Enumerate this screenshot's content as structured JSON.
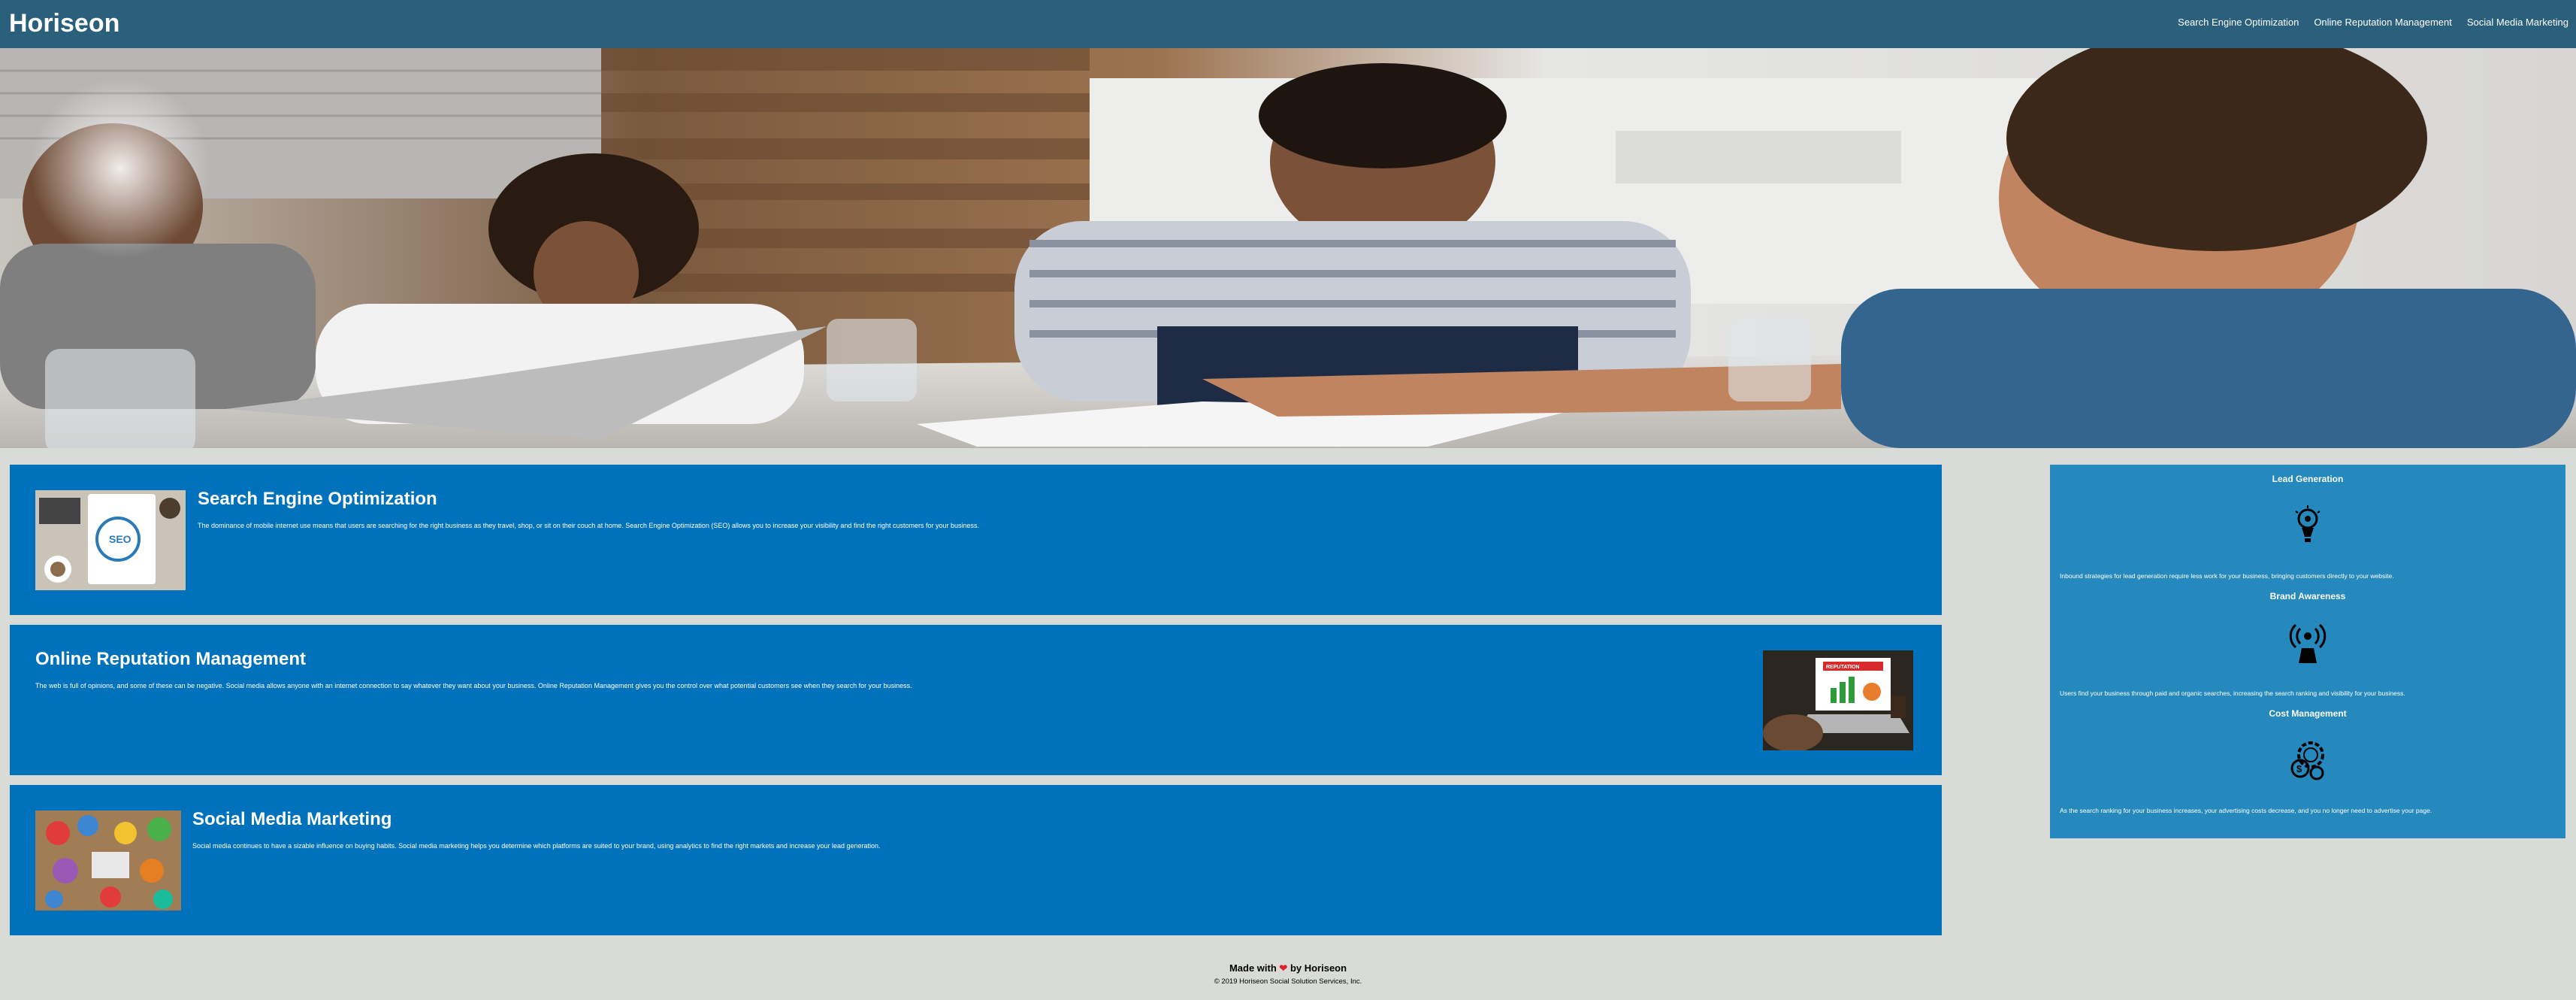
{
  "header": {
    "logo": "Horiseon",
    "nav": [
      "Search Engine Optimization",
      "Online Reputation Management",
      "Social Media Marketing"
    ]
  },
  "cards": [
    {
      "title": "Search Engine Optimization",
      "text": "The dominance of mobile internet use means that users are searching for the right business as they travel, shop, or sit on their couch at home. Search Engine Optimization (SEO) allows you to increase your visibility and find the right customers for your business."
    },
    {
      "title": "Online Reputation Management",
      "text": "The web is full of opinions, and some of these can be negative. Social media allows anyone with an internet connection to say whatever they want about your business. Online Reputation Management gives you the control over what potential customers see when they search for your business."
    },
    {
      "title": "Social Media Marketing",
      "text": "Social media continues to have a sizable influence on buying habits. Social media marketing helps you determine which platforms are suited to your brand, using analytics to find the right markets and increase your lead generation."
    }
  ],
  "benefits": [
    {
      "title": "Lead Generation",
      "icon": "lightbulb-gear-icon",
      "text": "Inbound strategies for lead generation require less work for your business, bringing customers directly to your website."
    },
    {
      "title": "Brand Awareness",
      "icon": "broadcast-person-icon",
      "text": "Users find your business through paid and organic searches, increasing the search ranking and visibility for your business."
    },
    {
      "title": "Cost Management",
      "icon": "gear-coins-icon",
      "text": "As the search ranking for your business increases, your advertising costs decrease, and you no longer need to advertise your page."
    }
  ],
  "footer": {
    "made_with_prefix": "Made with",
    "heart": "❤",
    "made_with_suffix": "by Horiseon",
    "copyright": "© 2019 Horiseon Social Solution Services, Inc."
  },
  "colors": {
    "header": "#2a607c",
    "card": "#0072bb",
    "benefits": "#2589bd",
    "background": "#d9dcd6"
  }
}
